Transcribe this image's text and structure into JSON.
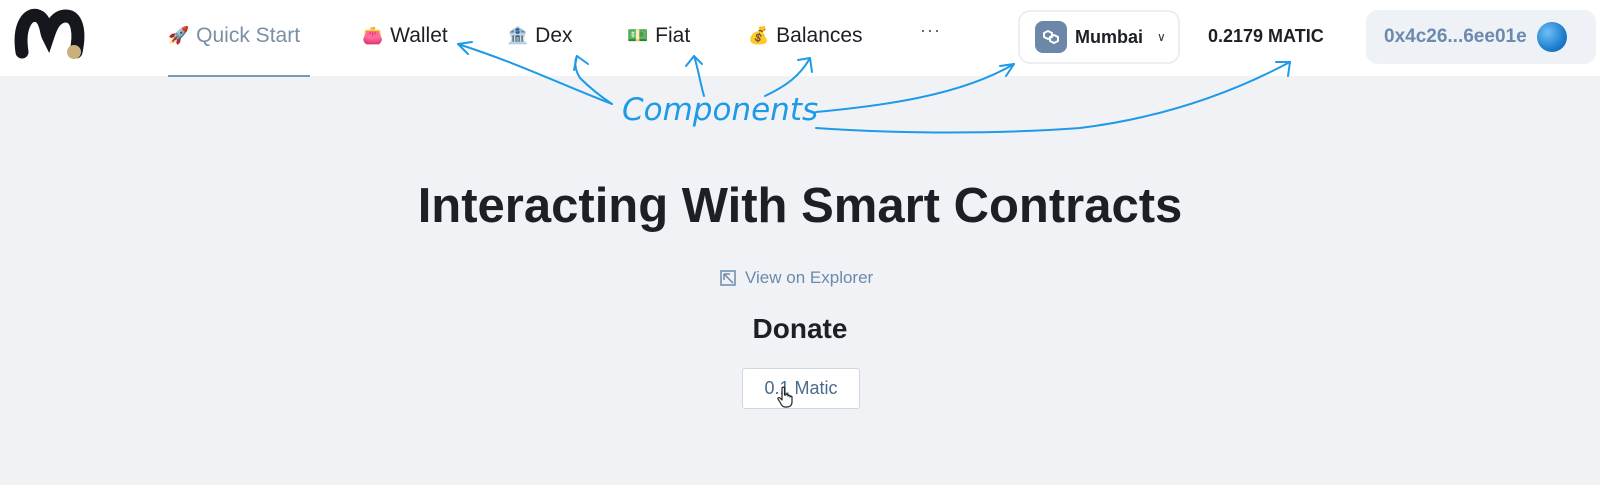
{
  "nav": {
    "items": [
      {
        "label": "Quick Start",
        "emoji": "🚀",
        "icon": "rocket-icon",
        "active": true
      },
      {
        "label": "Wallet",
        "emoji": "👛",
        "icon": "wallet-icon",
        "active": false
      },
      {
        "label": "Dex",
        "emoji": "🏦",
        "icon": "bank-icon",
        "active": false
      },
      {
        "label": "Fiat",
        "emoji": "💵",
        "icon": "dollar-bill-icon",
        "active": false
      },
      {
        "label": "Balances",
        "emoji": "💰",
        "icon": "money-bag-icon",
        "active": false
      }
    ],
    "more": "···"
  },
  "chain": {
    "name": "Mumbai",
    "caret": "∨",
    "icon": "polygon-icon"
  },
  "balance": "0.2179 MATIC",
  "account": {
    "address": "0x4c26...6ee01e"
  },
  "annotation": {
    "label": "Components",
    "color": "#1d9ae8"
  },
  "main": {
    "title": "Interacting With Smart Contracts",
    "explorer_link": "View on Explorer",
    "section": "Donate",
    "donate_button": "0.1 Matic"
  },
  "colors": {
    "accent": "#6b8aad",
    "background": "#f0f2f5",
    "text": "#1c1f26"
  }
}
